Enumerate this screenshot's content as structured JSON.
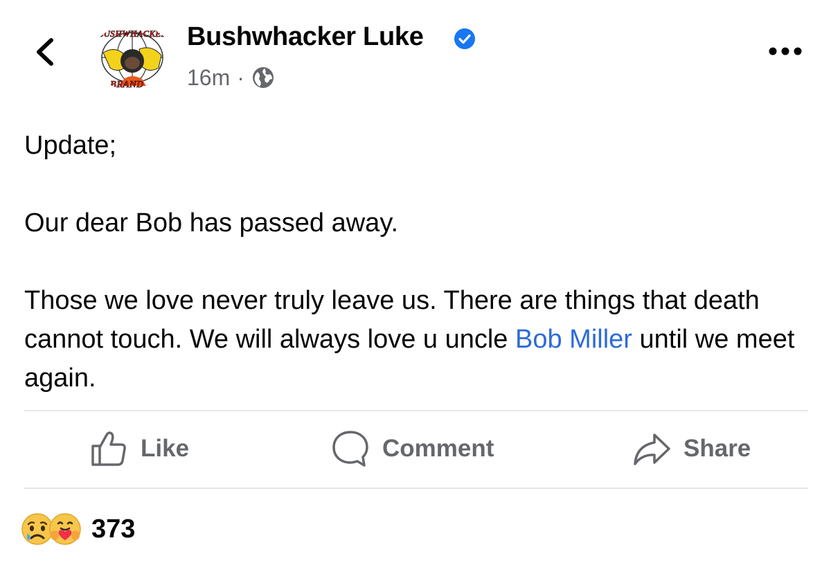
{
  "post": {
    "author": "Bushwhacker Luke",
    "avatar_text_top": "BUSHWHACKER",
    "avatar_text_bottom": "BRAND",
    "timestamp": "16m",
    "separator": "·",
    "audience_icon": "globe-icon",
    "body": {
      "line1": "Update;",
      "line2": "Our dear Bob has passed away.",
      "line3_before": "Those we love never truly leave us. There are things that death cannot touch.  We will always love u uncle ",
      "mention": "Bob Miller",
      "line3_after": " until we meet again."
    }
  },
  "actions": {
    "like": "Like",
    "comment": "Comment",
    "share": "Share"
  },
  "reactions": {
    "icons": [
      "sad-reaction-icon",
      "care-reaction-icon"
    ],
    "count": "373"
  },
  "colors": {
    "text": "#050505",
    "secondary": "#65676b",
    "link": "#2d6bd8",
    "verified": "#1877f2",
    "divider": "#e4e6eb"
  }
}
